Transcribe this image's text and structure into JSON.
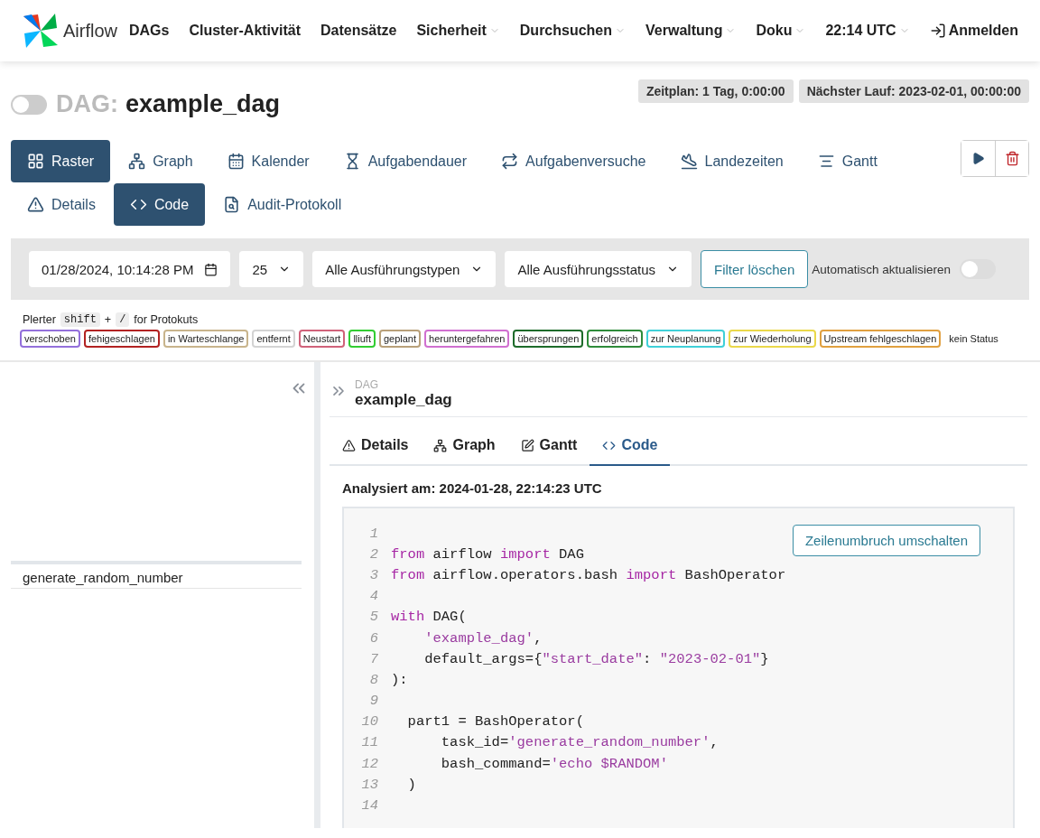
{
  "header": {
    "brand": "Airflow",
    "nav": [
      {
        "label": "DAGs",
        "dropdown": false
      },
      {
        "label": "Cluster-Aktivität",
        "dropdown": false
      },
      {
        "label": "Datensätze",
        "dropdown": false
      },
      {
        "label": "Sicherheit",
        "dropdown": true
      },
      {
        "label": "Durchsuchen",
        "dropdown": true
      },
      {
        "label": "Verwaltung",
        "dropdown": true
      },
      {
        "label": "Doku",
        "dropdown": true
      },
      {
        "label": "22:14 UTC",
        "dropdown": true
      }
    ],
    "login": "Anmelden"
  },
  "dag": {
    "prefix": "DAG:",
    "name": "example_dag",
    "on": false,
    "badges": [
      "Zeitplan: 1 Tag, 0:00:00",
      "Nächster Lauf: 2023-02-01, 00:00:00"
    ]
  },
  "views": [
    [
      {
        "label": "Raster",
        "selected": true
      },
      {
        "label": "Graph",
        "selected": false
      },
      {
        "label": "Kalender",
        "selected": false
      },
      {
        "label": "Aufgabendauer",
        "selected": false
      },
      {
        "label": "Aufgabenversuche",
        "selected": false
      },
      {
        "label": "Landezeiten",
        "selected": false
      },
      {
        "label": "Gantt",
        "selected": false
      }
    ],
    [
      {
        "label": "Details",
        "selected": false
      },
      {
        "label": "Code",
        "selected": true
      },
      {
        "label": "Audit-Protokoll",
        "selected": false
      }
    ]
  ],
  "filters": {
    "date": "01/28/2024, 10:14:28 PM",
    "count": "25",
    "run_type": "Alle Ausführungstypen",
    "run_state": "Alle Ausführungsstatus",
    "clear": "Filter löschen",
    "auto_refresh": {
      "label": "Automatisch aktualisieren",
      "on": false
    }
  },
  "hint": {
    "before": "Plerter",
    "key1": "shift",
    "plus": "+",
    "key2": "/",
    "after": "for Protokuts"
  },
  "legend": [
    {
      "label": "verschoben",
      "color": "#9370db"
    },
    {
      "label": "fehigeschlagen",
      "color": "#b22222"
    },
    {
      "label": "in Warteschlange",
      "color": "#c8b48c"
    },
    {
      "label": "entfernt",
      "color": "#d3d3d3"
    },
    {
      "label": "Neustart",
      "color": "#d0627a"
    },
    {
      "label": "lliuft",
      "color": "#32cd32"
    },
    {
      "label": "geplant",
      "color": "#b8a07a"
    },
    {
      "label": "heruntergefahren",
      "color": "#d070d0"
    },
    {
      "label": "übersprungen",
      "color": "#1d6b2a"
    },
    {
      "label": "erfolgreich",
      "color": "#2e8b3a"
    },
    {
      "label": "zur Neuplanung",
      "color": "#40d0d8"
    },
    {
      "label": "zur Wiederholung",
      "color": "#ead84a"
    },
    {
      "label": "Upstream fehlgeschlagen",
      "color": "#e0a040"
    },
    {
      "label": "kein Status"
    }
  ],
  "grid": {
    "tasks": [
      "generate_random_number"
    ]
  },
  "details": {
    "caption": "DAG",
    "title": "example_dag",
    "tabs": [
      {
        "label": "Details",
        "selected": false
      },
      {
        "label": "Graph",
        "selected": false
      },
      {
        "label": "Gantt",
        "selected": false
      },
      {
        "label": "Code",
        "selected": true
      }
    ],
    "parsed": "Analysiert am: 2024-01-28, 22:14:23 UTC",
    "wrap_button": "Zeilenumbruch umschalten",
    "code": [
      {
        "number": "1"
      },
      {
        "number": "2",
        "tokens": [
          {
            "text": "from",
            "kind": "kw"
          },
          {
            "text": " airflow ",
            "kind": "plain"
          },
          {
            "text": "import",
            "kind": "kw"
          },
          {
            "text": " DAG",
            "kind": "plain"
          }
        ]
      },
      {
        "number": "3",
        "tokens": [
          {
            "text": "from",
            "kind": "kw"
          },
          {
            "text": " airflow.operators.bash ",
            "kind": "plain"
          },
          {
            "text": "import",
            "kind": "kw"
          },
          {
            "text": " BashOperator",
            "kind": "plain"
          }
        ]
      },
      {
        "number": "4"
      },
      {
        "number": "5",
        "tokens": [
          {
            "text": "with",
            "kind": "kw"
          },
          {
            "text": " DAG(",
            "kind": "plain"
          }
        ]
      },
      {
        "number": "6",
        "tokens": [
          {
            "text": "    'example_dag'",
            "kind": "str"
          },
          {
            "text": ",",
            "kind": "plain"
          }
        ]
      },
      {
        "number": "7",
        "tokens": [
          {
            "text": "    default_args={",
            "kind": "plain"
          },
          {
            "text": "\"start_date\"",
            "kind": "str"
          },
          {
            "text": ": ",
            "kind": "plain"
          },
          {
            "text": "\"2023-02-01\"",
            "kind": "str"
          },
          {
            "text": "}",
            "kind": "plain"
          }
        ]
      },
      {
        "number": "8",
        "tokens": [
          {
            "text": "):",
            "kind": "plain"
          }
        ]
      },
      {
        "number": "9"
      },
      {
        "number": "10",
        "tokens": [
          {
            "text": "  part1 = BashOperator(",
            "kind": "plain"
          }
        ]
      },
      {
        "number": "11",
        "tokens": [
          {
            "text": "      task_id=",
            "kind": "plain"
          },
          {
            "text": "'generate_random_number'",
            "kind": "str"
          },
          {
            "text": ",",
            "kind": "plain"
          }
        ]
      },
      {
        "number": "12",
        "tokens": [
          {
            "text": "      bash_command=",
            "kind": "plain"
          },
          {
            "text": "'echo $RANDOM'",
            "kind": "str"
          }
        ]
      },
      {
        "number": "13",
        "tokens": [
          {
            "text": "  )",
            "kind": "plain"
          }
        ]
      },
      {
        "number": "14"
      }
    ]
  }
}
